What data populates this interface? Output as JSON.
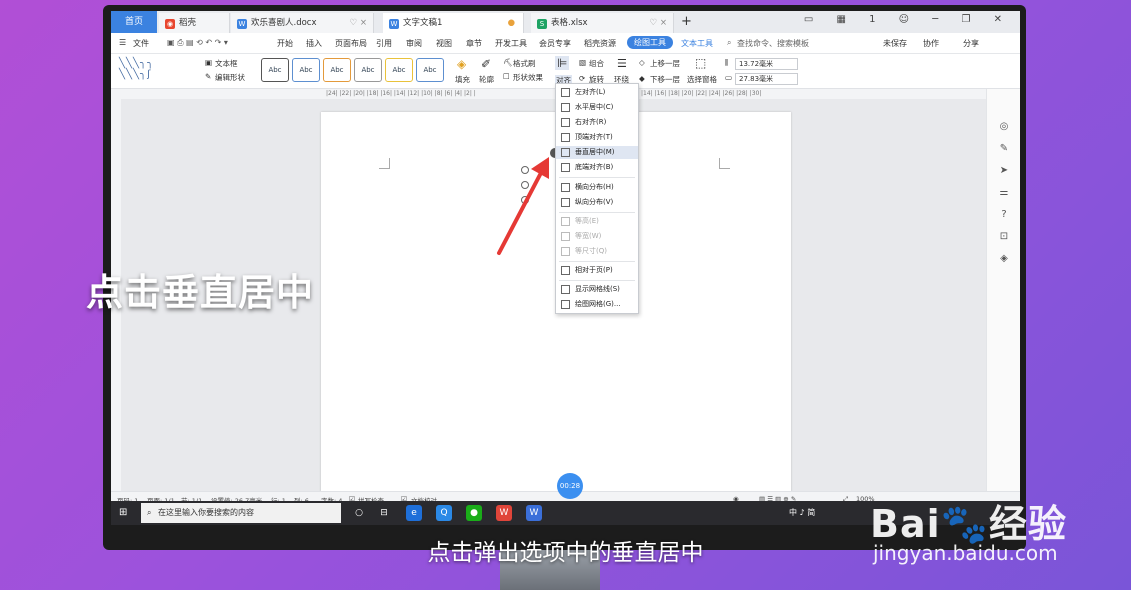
{
  "tabs": {
    "home": "首页",
    "items": [
      {
        "label": "稻壳",
        "icon": "docer-icon",
        "color": "#e8462f"
      },
      {
        "label": "欢乐喜剧人.docx",
        "icon": "word-doc-icon",
        "color": "#3b82e0"
      },
      {
        "label": "文字文稿1",
        "icon": "word-doc-icon",
        "color": "#3b82e0",
        "active": true
      },
      {
        "label": "表格.xlsx",
        "icon": "sheet-icon",
        "color": "#1ea364"
      }
    ],
    "add": "+"
  },
  "menu": {
    "file": "文件",
    "items": [
      "开始",
      "插入",
      "页面布局",
      "引用",
      "审阅",
      "视图",
      "章节",
      "开发工具",
      "会员专享",
      "稻壳资源"
    ],
    "active": "绘图工具",
    "text_tool": "文本工具",
    "search": "查找命令、搜索模板",
    "unsaved": "未保存",
    "collab": "协作",
    "share": "分享"
  },
  "ribbon": {
    "textbox": "文本框",
    "edit_shape": "编辑形状",
    "style_sample": "Abc",
    "fill": "填充",
    "outline": "轮廓",
    "format_brush": "格式刷",
    "shape_effect": "形状效果",
    "align": "对齐",
    "group": "组合",
    "rotate": "旋转",
    "wrap": "环绕",
    "bring_up": "上移一层",
    "send_down": "下移一层",
    "select_pane": "选择窗格",
    "width": "13.72毫米",
    "height": "27.83毫米"
  },
  "ruler": "|24| |22| |20| |18| |16| |14| |12| |10| |8| |6| |4| |2| |",
  "ruler_right": "|14| |16| |18| |20| |22| |24| |26| |28| |30|",
  "dropdown": [
    {
      "label": "左对齐(L)"
    },
    {
      "label": "水平居中(C)"
    },
    {
      "label": "右对齐(R)"
    },
    {
      "label": "顶端对齐(T)"
    },
    {
      "label": "垂直居中(M)",
      "highlight": true
    },
    {
      "label": "底端对齐(B)"
    },
    {
      "label": "横向分布(H)",
      "sep_before": true
    },
    {
      "label": "纵向分布(V)"
    },
    {
      "label": "等高(E)",
      "disabled": true,
      "sep_before": true
    },
    {
      "label": "等宽(W)",
      "disabled": true
    },
    {
      "label": "等尺寸(Q)",
      "disabled": true
    },
    {
      "label": "相对于页(P)",
      "sep_before": true
    },
    {
      "label": "显示网格线(S)",
      "sep_before": true
    },
    {
      "label": "绘图网格(G)..."
    }
  ],
  "status": {
    "page": "页码: 1",
    "pages": "页面: 1/1",
    "section": "节: 1/1",
    "setting": "设置值: 26.7毫米",
    "row": "行: 1",
    "col": "列: 6",
    "words": "字数: 4",
    "spell": "拼写检查",
    "proof": "文档校对",
    "zoom": "100%"
  },
  "timer": "00:28",
  "taskbar": {
    "search_placeholder": "在这里输入你要搜索的内容",
    "tray": "中 ♪ 简"
  },
  "overlay": {
    "caption_big": "点击垂直居中",
    "caption_sub": "点击弹出选项中的垂直居中",
    "watermark_logo": "Bai🐾经验",
    "watermark_url": "jingyan.baidu.com"
  }
}
